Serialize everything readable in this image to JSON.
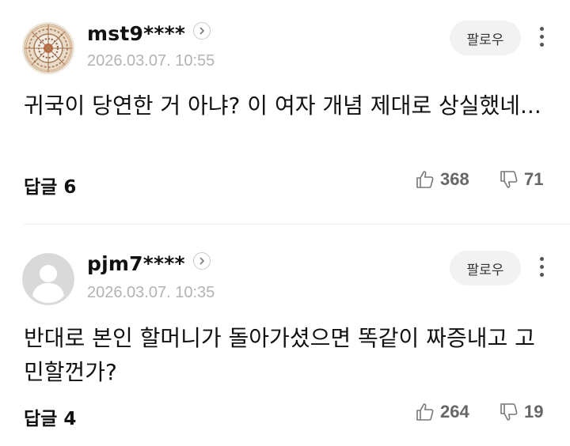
{
  "comments": [
    {
      "username": "mst9****",
      "date": "2026.03.07. 10:55",
      "follow_label": "팔로우",
      "text": "귀국이 당연한 거 아냐? 이 여자 개념 제대로 상실했네...",
      "reply_label": "답글 6",
      "likes": "368",
      "dislikes": "71",
      "avatar": "mandala-avatar"
    },
    {
      "username": "pjm7****",
      "date": "2026.03.07. 10:35",
      "follow_label": "팔로우",
      "text": "반대로 본인 할머니가 돌아가셨으면 똑같이 짜증내고 고민할껀가?",
      "reply_label": "답글 4",
      "likes": "264",
      "dislikes": "19",
      "avatar": "default-person-avatar"
    }
  ],
  "colors": {
    "date": "#b3b3b3",
    "follow_bg": "#f2f2f2",
    "divider": "#ececec",
    "count": "#666666"
  }
}
